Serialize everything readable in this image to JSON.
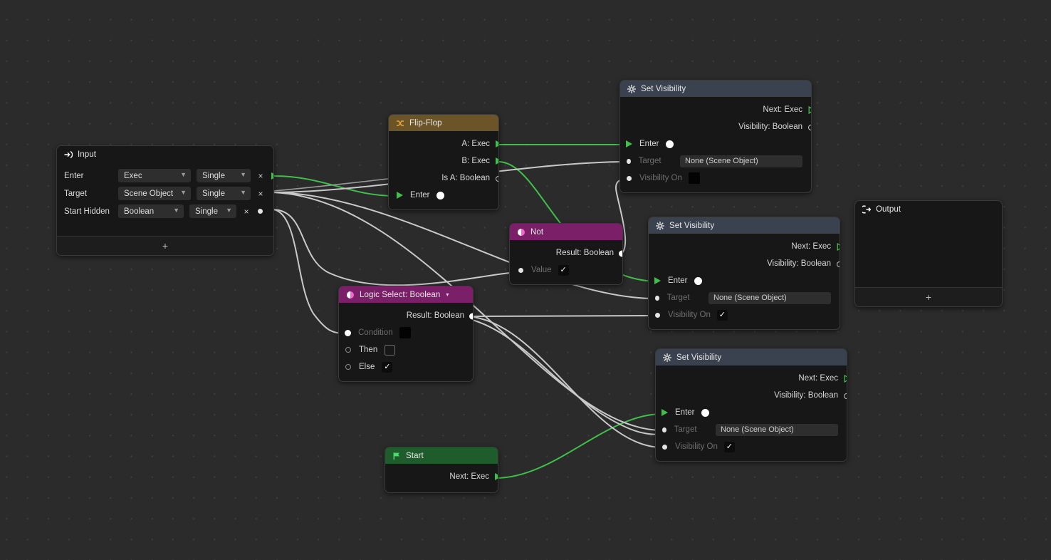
{
  "canvas": {
    "background_color": "#2b2b2b",
    "grid_dot_color": "#3b3b3b",
    "wire_exec_color": "#3fc04a",
    "wire_data_color": "#c9c9c9"
  },
  "nodes": {
    "input": {
      "title": "Input",
      "icon": "input-arrow-icon",
      "header_color": "#171717",
      "rows": [
        {
          "label": "Enter",
          "type": "Exec",
          "cardinality": "Single",
          "remove": "×",
          "port": "exec"
        },
        {
          "label": "Target",
          "type": "Scene Object",
          "cardinality": "Single",
          "remove": "×",
          "port": "data"
        },
        {
          "label": "Start Hidden",
          "type": "Boolean",
          "cardinality": "Single",
          "remove": "×",
          "port": "data"
        }
      ],
      "add_label": "+"
    },
    "flipflop": {
      "title": "Flip-Flop",
      "icon": "flipflop-icon",
      "header_color": "#6b5428",
      "outputs": [
        {
          "label": "A: Exec",
          "port": "exec-filled"
        },
        {
          "label": "B: Exec",
          "port": "exec-filled"
        },
        {
          "label": "Is A: Boolean",
          "port": "ring"
        }
      ],
      "inputs": [
        {
          "label": "Enter",
          "port": "exec-filled",
          "widget": "dot"
        }
      ]
    },
    "not": {
      "title": "Not",
      "icon": "contrast-icon",
      "header_color": "#7a1f68",
      "outputs": [
        {
          "label": "Result: Boolean",
          "port": "dot"
        }
      ],
      "inputs": [
        {
          "label": "Value",
          "port": "dot",
          "widget": "checkbox",
          "checked": true
        }
      ]
    },
    "logic_select": {
      "title": "Logic Select: Boolean",
      "title_caret": "▾",
      "icon": "contrast-icon",
      "header_color": "#7a1f68",
      "outputs": [
        {
          "label": "Result: Boolean",
          "port": "dot"
        }
      ],
      "inputs": [
        {
          "label": "Condition",
          "port": "dot",
          "widget": "swatch",
          "dim": true
        },
        {
          "label": "Then",
          "port": "ring",
          "widget": "checkbox",
          "checked": false,
          "dim": false
        },
        {
          "label": "Else",
          "port": "ring",
          "widget": "checkbox",
          "checked": true,
          "dim": false
        }
      ]
    },
    "set_visibility_1": {
      "title": "Set Visibility",
      "icon": "gear-icon",
      "header_color": "#3a4250",
      "outputs": [
        {
          "label": "Next: Exec",
          "port": "exec-hollow"
        },
        {
          "label": "Visibility: Boolean",
          "port": "ring"
        }
      ],
      "inputs": [
        {
          "label": "Enter",
          "port": "exec-filled",
          "widget": "dot"
        },
        {
          "label": "Target",
          "port": "dot",
          "widget": "textfield",
          "value": "None (Scene Object)",
          "dim": true
        },
        {
          "label": "Visibility On",
          "port": "dot",
          "widget": "swatch",
          "dim": true
        }
      ]
    },
    "set_visibility_2": {
      "title": "Set Visibility",
      "icon": "gear-icon",
      "header_color": "#3a4250",
      "outputs": [
        {
          "label": "Next: Exec",
          "port": "exec-hollow"
        },
        {
          "label": "Visibility: Boolean",
          "port": "ring"
        }
      ],
      "inputs": [
        {
          "label": "Enter",
          "port": "exec-filled",
          "widget": "dot"
        },
        {
          "label": "Target",
          "port": "dot",
          "widget": "textfield",
          "value": "None (Scene Object)",
          "dim": true
        },
        {
          "label": "Visibility On",
          "port": "dot",
          "widget": "checkbox",
          "checked": true,
          "dim": true
        }
      ]
    },
    "set_visibility_3": {
      "title": "Set Visibility",
      "icon": "gear-icon",
      "header_color": "#3a4250",
      "outputs": [
        {
          "label": "Next: Exec",
          "port": "exec-hollow"
        },
        {
          "label": "Visibility: Boolean",
          "port": "ring"
        }
      ],
      "inputs": [
        {
          "label": "Enter",
          "port": "exec-filled",
          "widget": "dot"
        },
        {
          "label": "Target",
          "port": "dot",
          "widget": "textfield",
          "value": "None (Scene Object)",
          "dim": true
        },
        {
          "label": "Visibility On",
          "port": "dot",
          "widget": "checkbox",
          "checked": true,
          "dim": true
        }
      ]
    },
    "start": {
      "title": "Start",
      "icon": "flag-icon",
      "header_color": "#1f5c2b",
      "outputs": [
        {
          "label": "Next: Exec",
          "port": "exec-filled"
        }
      ]
    },
    "output": {
      "title": "Output",
      "icon": "output-arrow-icon",
      "header_color": "#171717",
      "add_label": "+"
    }
  }
}
